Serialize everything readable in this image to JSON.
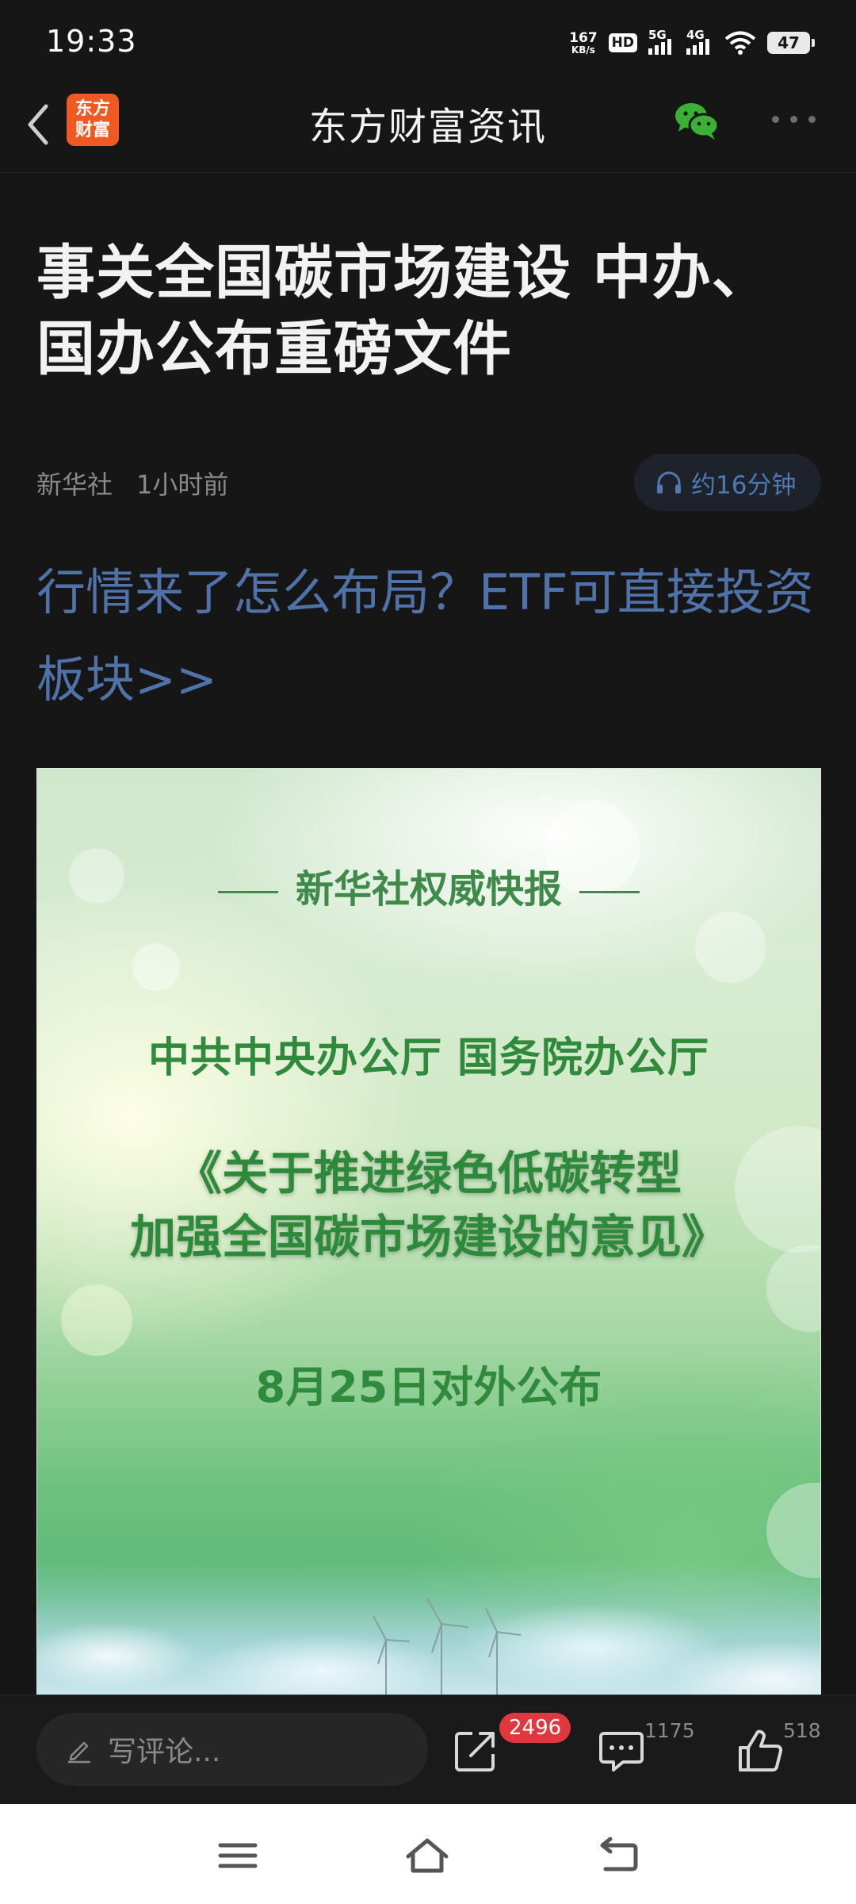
{
  "status_bar": {
    "time": "19:33",
    "net_speed_value": "167",
    "net_speed_unit": "KB/s",
    "hd_label": "HD",
    "sim1_label": "5G",
    "sim2_label": "4G",
    "battery": "47"
  },
  "header": {
    "logo_text_line1": "东方",
    "logo_text_line2": "财富",
    "title": "东方财富资讯",
    "brand_color": "#f05a22",
    "wechat_color": "#3cb034"
  },
  "article": {
    "title": "事关全国碳市场建设 中办、国办公布重磅文件",
    "source": "新华社",
    "time_ago": "1小时前",
    "listen_duration": "约16分钟",
    "promo_link": "行情来了怎么布局？ETF可直接投资板块>>"
  },
  "hero_image": {
    "kicker": "新华社权威快报",
    "issuers": "中共中央办公厅 国务院办公厅",
    "document_line1": "《关于推进绿色低碳转型",
    "document_line2": "加强全国碳市场建设的意见》",
    "release_date": "8月25日对外公布"
  },
  "comment_bar": {
    "input_placeholder": "写评论...",
    "share_count": "2496",
    "comments_count": "1175",
    "likes_count": "518",
    "badge_color": "#e0383e"
  }
}
